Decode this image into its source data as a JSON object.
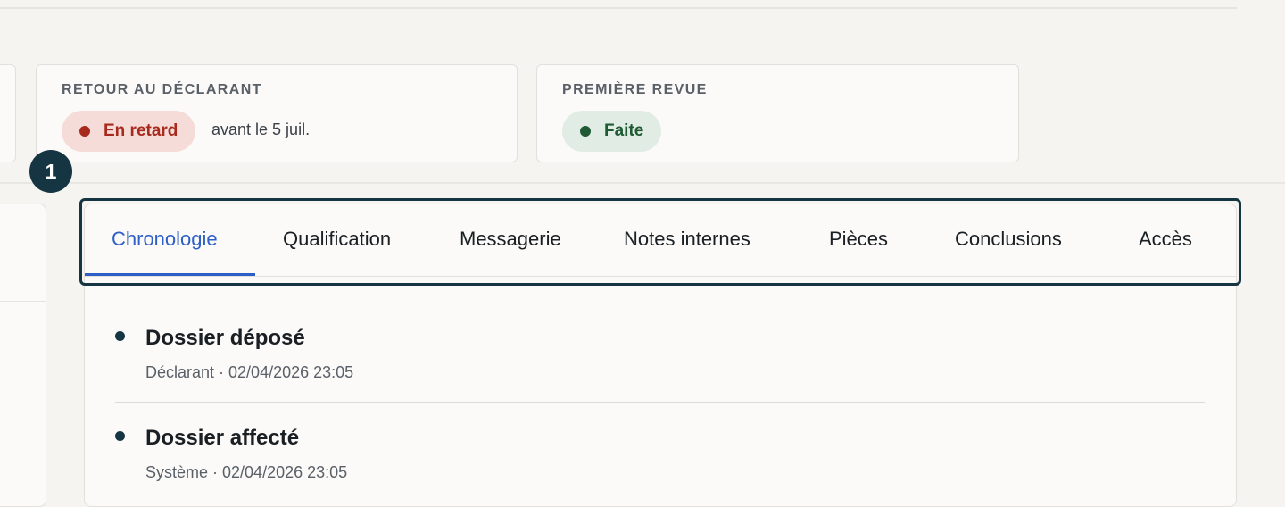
{
  "cards": {
    "retour": {
      "label": "RETOUR AU DÉCLARANT",
      "status": "En retard",
      "due": "avant le 5 juil."
    },
    "revue": {
      "label": "PREMIÈRE REVUE",
      "status": "Faite"
    }
  },
  "step_badge": "1",
  "tabs": [
    {
      "label": "Chronologie",
      "active": true
    },
    {
      "label": "Qualification"
    },
    {
      "label": "Messagerie"
    },
    {
      "label": "Notes internes"
    },
    {
      "label": "Pièces"
    },
    {
      "label": "Conclusions"
    },
    {
      "label": "Accès"
    }
  ],
  "timeline": [
    {
      "title": "Dossier déposé",
      "meta": "Déclarant · 02/04/2026 23:05"
    },
    {
      "title": "Dossier affecté",
      "meta": "Système · 02/04/2026 23:05"
    }
  ],
  "colors": {
    "accent": "#2e5fc7",
    "late": "#a72a1d",
    "done": "#1f5a35",
    "focus": "#163543"
  }
}
